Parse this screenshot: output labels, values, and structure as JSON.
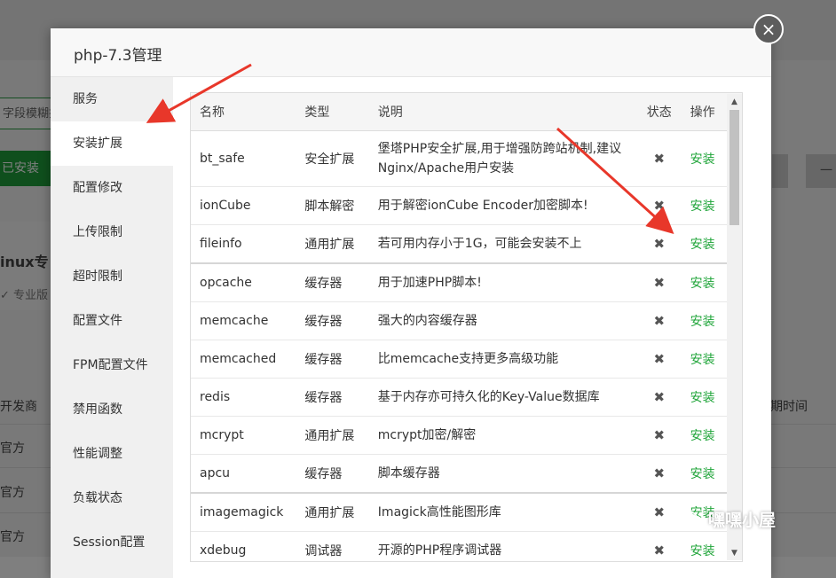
{
  "background": {
    "search_text": "字段模糊搜",
    "installed_button": "已安装",
    "right_button": "一",
    "banner_title": "inux专",
    "banner_sub": "专业版",
    "col_left": "开发商",
    "col_right": "期时间",
    "rows": [
      "官方",
      "官方",
      "官方"
    ]
  },
  "dialog": {
    "title": "php-7.3管理",
    "close_icon": "×"
  },
  "sidebar": {
    "items": [
      {
        "label": "服务"
      },
      {
        "label": "安装扩展"
      },
      {
        "label": "配置修改"
      },
      {
        "label": "上传限制"
      },
      {
        "label": "超时限制"
      },
      {
        "label": "配置文件"
      },
      {
        "label": "FPM配置文件"
      },
      {
        "label": "禁用函数"
      },
      {
        "label": "性能调整"
      },
      {
        "label": "负载状态"
      },
      {
        "label": "Session配置"
      }
    ],
    "active_index": 1
  },
  "table": {
    "headers": {
      "name": "名称",
      "type": "类型",
      "desc": "说明",
      "status": "状态",
      "action": "操作"
    },
    "rows": [
      {
        "name": "bt_safe",
        "type": "安全扩展",
        "desc": "堡塔PHP安全扩展,用于增强防跨站机制,建议Nginx/Apache用户安装",
        "status": "✖",
        "action": "安装"
      },
      {
        "name": "ionCube",
        "type": "脚本解密",
        "desc": "用于解密ionCube Encoder加密脚本!",
        "status": "✖",
        "action": "安装"
      },
      {
        "name": "fileinfo",
        "type": "通用扩展",
        "desc": "若可用内存小于1G，可能会安装不上",
        "status": "✖",
        "action": "安装"
      },
      {
        "name": "opcache",
        "type": "缓存器",
        "desc": "用于加速PHP脚本!",
        "status": "✖",
        "action": "安装"
      },
      {
        "name": "memcache",
        "type": "缓存器",
        "desc": "强大的内容缓存器",
        "status": "✖",
        "action": "安装"
      },
      {
        "name": "memcached",
        "type": "缓存器",
        "desc": "比memcache支持更多高级功能",
        "status": "✖",
        "action": "安装"
      },
      {
        "name": "redis",
        "type": "缓存器",
        "desc": "基于内存亦可持久化的Key-Value数据库",
        "status": "✖",
        "action": "安装"
      },
      {
        "name": "mcrypt",
        "type": "通用扩展",
        "desc": "mcrypt加密/解密",
        "status": "✖",
        "action": "安装"
      },
      {
        "name": "apcu",
        "type": "缓存器",
        "desc": "脚本缓存器",
        "status": "✖",
        "action": "安装"
      },
      {
        "name": "imagemagick",
        "type": "通用扩展",
        "desc": "Imagick高性能图形库",
        "status": "✖",
        "action": "安装"
      },
      {
        "name": "xdebug",
        "type": "调试器",
        "desc": "开源的PHP程序调试器",
        "status": "✖",
        "action": "安装"
      }
    ]
  },
  "watermark": {
    "text": "嘿嘿小屋",
    "icon": "wechat-icon"
  },
  "colors": {
    "accent": "#20a53a",
    "arrow": "#e8372a",
    "close_bg": "#5d5d5d"
  }
}
